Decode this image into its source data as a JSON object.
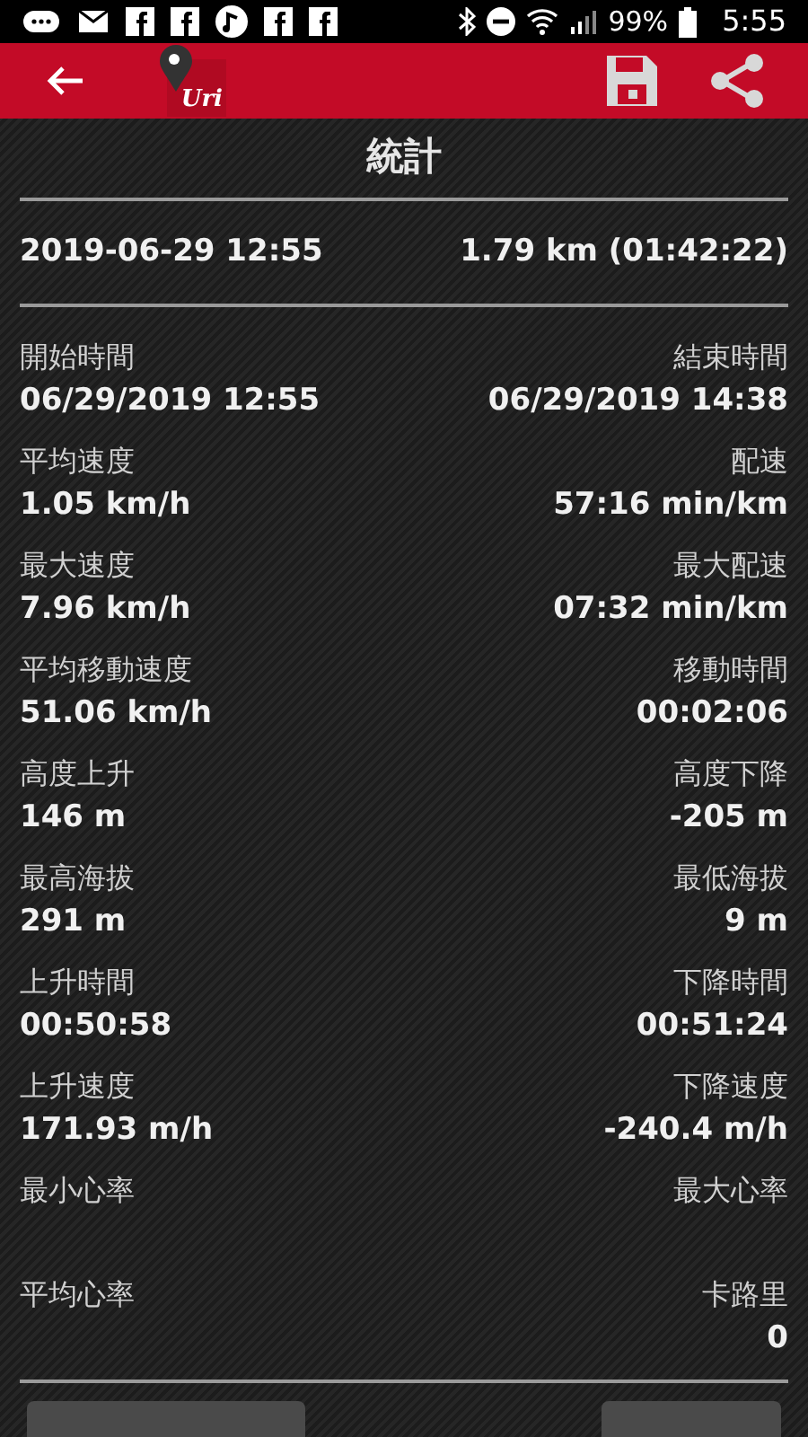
{
  "status_bar": {
    "battery": "99%",
    "time": "5:55"
  },
  "app_bar": {
    "logo_text": "Uri"
  },
  "title": "統計",
  "summary": {
    "date": "2019-06-29 12:55",
    "distance": "1.79 km (01:42:22)"
  },
  "rows": [
    {
      "left": {
        "label": "開始時間",
        "value": "06/29/2019 12:55"
      },
      "right": {
        "label": "結束時間",
        "value": "06/29/2019 14:38"
      }
    },
    {
      "left": {
        "label": "平均速度",
        "value": "1.05 km/h"
      },
      "right": {
        "label": "配速",
        "value": "57:16 min/km"
      }
    },
    {
      "left": {
        "label": "最大速度",
        "value": "7.96 km/h"
      },
      "right": {
        "label": "最大配速",
        "value": "07:32 min/km"
      }
    },
    {
      "left": {
        "label": "平均移動速度",
        "value": "51.06 km/h"
      },
      "right": {
        "label": "移動時間",
        "value": "00:02:06"
      }
    },
    {
      "left": {
        "label": "高度上升",
        "value": "146 m"
      },
      "right": {
        "label": "高度下降",
        "value": "-205 m"
      }
    },
    {
      "left": {
        "label": "最高海拔",
        "value": "291 m"
      },
      "right": {
        "label": "最低海拔",
        "value": "9 m"
      }
    },
    {
      "left": {
        "label": "上升時間",
        "value": "00:50:58"
      },
      "right": {
        "label": "下降時間",
        "value": "00:51:24"
      }
    },
    {
      "left": {
        "label": "上升速度",
        "value": "171.93 m/h"
      },
      "right": {
        "label": "下降速度",
        "value": "-240.4 m/h"
      }
    },
    {
      "left": {
        "label": "最小心率"
      },
      "right": {
        "label": "最大心率"
      }
    },
    {
      "left": {
        "label": "平均心率"
      },
      "right": {
        "label": "卡路里",
        "value": "0"
      }
    }
  ]
}
